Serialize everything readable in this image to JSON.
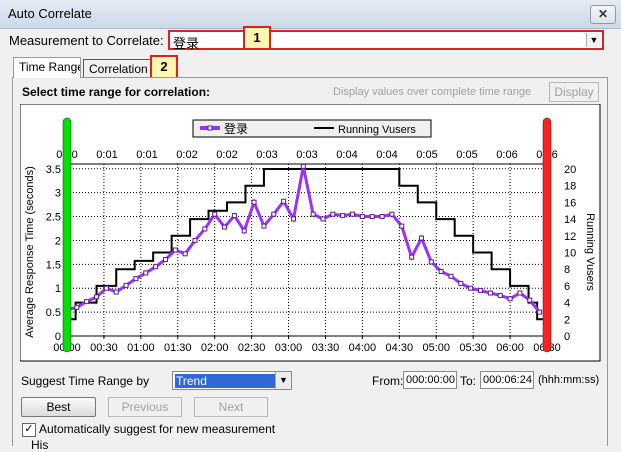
{
  "window": {
    "title": "Auto Correlate",
    "close": "✕"
  },
  "measurement": {
    "label": "Measurement to Correlate:",
    "value": "登录"
  },
  "callouts": [
    "1",
    "2"
  ],
  "tabs": [
    {
      "label": "Time Range"
    },
    {
      "label": "Correlation O"
    }
  ],
  "panel": {
    "heading": "Select time range for correlation:",
    "display_values_label": "Display values over complete time range",
    "display_button": "Display"
  },
  "chart_data": {
    "type": "line",
    "legend": [
      "登录",
      "Running Vusers"
    ],
    "ylabel": "Average Response Time (seconds)",
    "y2label": "Running Vusers",
    "ylim": [
      0,
      3.6
    ],
    "y2lim": [
      0,
      20.6
    ],
    "xlim": [
      0,
      390
    ],
    "yticks": [
      0,
      0.5,
      1,
      1.5,
      2,
      2.5,
      3,
      3.5
    ],
    "yticks_labels": [
      "0",
      "0.5",
      "1",
      "1.5",
      "2",
      "2.5",
      "3",
      "3.5"
    ],
    "y2ticks": [
      0,
      2,
      4,
      6,
      8,
      10,
      12,
      14,
      16,
      18,
      20
    ],
    "xticks_bottom": [
      "00:00",
      "00:30",
      "01:00",
      "01:30",
      "02:00",
      "02:30",
      "03:00",
      "03:30",
      "04:00",
      "04:30",
      "05:00",
      "05:30",
      "06:00",
      "06:30"
    ],
    "xticks_top": [
      "0:00",
      "0:01",
      "0:01",
      "0:02",
      "0:02",
      "0:03",
      "0:03",
      "0:04",
      "0:04",
      "0:05",
      "0:05",
      "0:06",
      "0:06"
    ],
    "series": [
      {
        "name": "登录",
        "color": "#9b30ff",
        "x": [
          0,
          8,
          16,
          24,
          32,
          40,
          48,
          56,
          64,
          72,
          80,
          88,
          96,
          104,
          112,
          120,
          128,
          136,
          144,
          152,
          160,
          168,
          176,
          184,
          192,
          200,
          208,
          216,
          224,
          232,
          240,
          248,
          256,
          264,
          272,
          280,
          288,
          296,
          304,
          312,
          320,
          328,
          336,
          344,
          352,
          360,
          368,
          376,
          384
        ],
        "y": [
          0.55,
          0.6,
          0.72,
          0.82,
          1.0,
          0.92,
          1.06,
          1.2,
          1.32,
          1.45,
          1.6,
          1.8,
          1.72,
          2.0,
          2.24,
          2.55,
          2.28,
          2.52,
          2.2,
          2.8,
          2.3,
          2.55,
          2.82,
          2.45,
          3.55,
          2.55,
          2.45,
          2.55,
          2.52,
          2.55,
          2.5,
          2.5,
          2.5,
          2.55,
          2.3,
          1.65,
          2.05,
          1.55,
          1.35,
          1.25,
          1.1,
          1.0,
          0.95,
          0.9,
          0.85,
          0.78,
          0.9,
          0.75,
          0.5
        ]
      },
      {
        "name": "Running Vusers",
        "color": "#000000",
        "x": [
          0,
          7,
          7,
          24,
          24,
          40,
          40,
          55,
          55,
          70,
          70,
          85,
          85,
          100,
          100,
          115,
          115,
          130,
          130,
          145,
          145,
          160,
          160,
          270,
          270,
          285,
          285,
          300,
          300,
          315,
          315,
          330,
          330,
          345,
          345,
          360,
          360,
          375,
          375,
          382,
          382,
          390
        ],
        "y": [
          2,
          2,
          4,
          4,
          6,
          6,
          8,
          8,
          9,
          9,
          10,
          10,
          12,
          12,
          14,
          14,
          15,
          15,
          16,
          16,
          18,
          18,
          20,
          20,
          18,
          18,
          16,
          16,
          14,
          14,
          12,
          12,
          10,
          10,
          8,
          8,
          6,
          6,
          4,
          4,
          2,
          2
        ]
      }
    ],
    "markers": [
      {
        "color": "#00e000",
        "x": 0
      },
      {
        "color": "#ff2020",
        "x": 390
      }
    ]
  },
  "suggest": {
    "label": "Suggest Time Range by",
    "value": "Trend"
  },
  "from": {
    "label": "From:",
    "value": "000:00:00"
  },
  "to": {
    "label": "To:",
    "value": "000:06:24"
  },
  "format": "(hhh:mm:ss)",
  "buttons": {
    "best": "Best",
    "previous": "Previous",
    "next": "Next"
  },
  "auto": {
    "label": "Automatically suggest for new measurement",
    "checked": "✓"
  },
  "cut_label": "His"
}
